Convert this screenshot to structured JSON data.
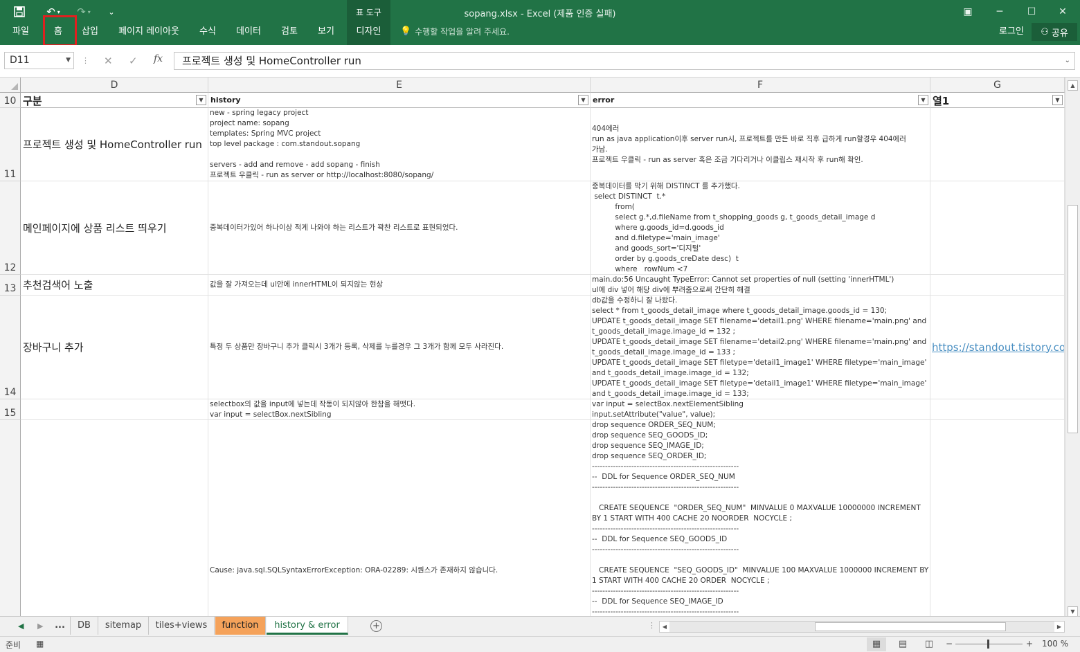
{
  "window": {
    "title": "sopang.xlsx - Excel (제품 인증 실패)",
    "context_tab_group": "표 도구"
  },
  "ribbon": {
    "tabs": [
      "파일",
      "홈",
      "삽입",
      "페이지 레이아웃",
      "수식",
      "데이터",
      "검토",
      "보기",
      "디자인"
    ],
    "tell_me": "수행할 작업을 알려 주세요.",
    "login": "로그인",
    "share": "공유",
    "highlight_color": "#e02020"
  },
  "formula_bar": {
    "name_box": "D11",
    "fx": "fx",
    "formula": "프로젝트 생성 및 HomeController run"
  },
  "columns": {
    "letters": [
      "D",
      "E",
      "F",
      "G"
    ],
    "headers": [
      "구분",
      "history",
      "error",
      "열1"
    ]
  },
  "rows": [
    {
      "num": "10"
    },
    {
      "num": "11",
      "category": "프로젝트 생성 및 HomeController run",
      "history": "new - spring legacy project\nproject name: sopang\ntemplates: Spring MVC project\ntop level package : com.standout.sopang\n\nservers - add and remove - add sopang - finish\n프로젝트 우클릭 - run as server or http://localhost:8080/sopang/",
      "error": "404에러\nrun as java application이후 server run시, 프로젝트를 만든 바로 직후 급하게 run할경우 404에러\n가남.\n프로젝트 우클릭 - run as server 혹은 조금 기다리거나 이클립스 재시작 후 run해 확인."
    },
    {
      "num": "12",
      "category": "메인페이지에 상품 리스트 띄우기",
      "history": "중복데이터가있어 하나이상 적게 나와야 하는 리스트가 꽉찬 리스트로 표현되었다.",
      "error": "중복데이터를 막기 위해 DISTINCT 를 추가했다.\n select DISTINCT  t.*\n          from(\n          select g.*,d.fileName from t_shopping_goods g, t_goods_detail_image d\n          where g.goods_id=d.goods_id\n          and d.filetype='main_image'\n          and goods_sort='디지털'\n          order by g.goods_creDate desc)  t\n          where   rowNum <7"
    },
    {
      "num": "13",
      "category": "추천검색어 노출",
      "history": "값을 잘 가져오는데 ul안에 innerHTML이 되지않는 현상",
      "error": "main.do:56 Uncaught TypeError: Cannot set properties of null (setting 'innerHTML')\nul에 div 넣어 해당 div에 뿌려줌으로써 간단히 해결"
    },
    {
      "num": "14",
      "category": "장바구니 추가",
      "history": "특정 두 상품만 장바구니 추가 클릭시 3개가 등록, 삭제를 누를경우 그 3개가 함께 모두 사라진다.",
      "error": "db값을 수정하니 잘 나왔다.\nselect * from t_goods_detail_image where t_goods_detail_image.goods_id = 130;\nUPDATE t_goods_detail_image SET filename='detail1.png' WHERE filename='main.png' and\nt_goods_detail_image.image_id = 132 ;\nUPDATE t_goods_detail_image SET filename='detail2.png' WHERE filename='main.png' and\nt_goods_detail_image.image_id = 133 ;\nUPDATE t_goods_detail_image SET filetype='detail1_image1' WHERE filetype='main_image'\nand t_goods_detail_image.image_id = 132;\nUPDATE t_goods_detail_image SET filetype='detail1_image1' WHERE filetype='main_image'\nand t_goods_detail_image.image_id = 133;",
      "col1": "https://standout.tistory.com"
    },
    {
      "num": "15",
      "category": "",
      "history": "selectbox의 값을 input에 넣는데 작동이 되지않아 한참을 해맷다.\nvar input = selectBox.nextSibling",
      "error": "var input = selectBox.nextElementSibling\ninput.setAttribute(\"value\", value);"
    },
    {
      "num": "",
      "category": "",
      "history": "Cause: java.sql.SQLSyntaxErrorException: ORA-02289: 시퀀스가 존재하지 않습니다.",
      "error": "drop sequence ORDER_SEQ_NUM;\ndrop sequence SEQ_GOODS_ID;\ndrop sequence SEQ_IMAGE_ID;\ndrop sequence SEQ_ORDER_ID;\n--------------------------------------------------------\n--  DDL for Sequence ORDER_SEQ_NUM\n--------------------------------------------------------\n\n   CREATE SEQUENCE  \"ORDER_SEQ_NUM\"  MINVALUE 0 MAXVALUE 10000000 INCREMENT\nBY 1 START WITH 400 CACHE 20 NOORDER  NOCYCLE ;\n--------------------------------------------------------\n--  DDL for Sequence SEQ_GOODS_ID\n--------------------------------------------------------\n\n   CREATE SEQUENCE  \"SEQ_GOODS_ID\"  MINVALUE 100 MAXVALUE 1000000 INCREMENT BY\n1 START WITH 400 CACHE 20 ORDER  NOCYCLE ;\n--------------------------------------------------------\n--  DDL for Sequence SEQ_IMAGE_ID\n--------------------------------------------------------"
    }
  ],
  "sheet_tabs": {
    "more": "...",
    "tabs": [
      "DB",
      "sitemap",
      "tiles+views",
      "function",
      "history & error"
    ],
    "active": "history & error",
    "highlighted_color": "#f5a25a"
  },
  "status": {
    "ready": "준비",
    "zoom": "100 %"
  },
  "colors": {
    "excel_green": "#217346",
    "link": "#4a8fc2"
  }
}
